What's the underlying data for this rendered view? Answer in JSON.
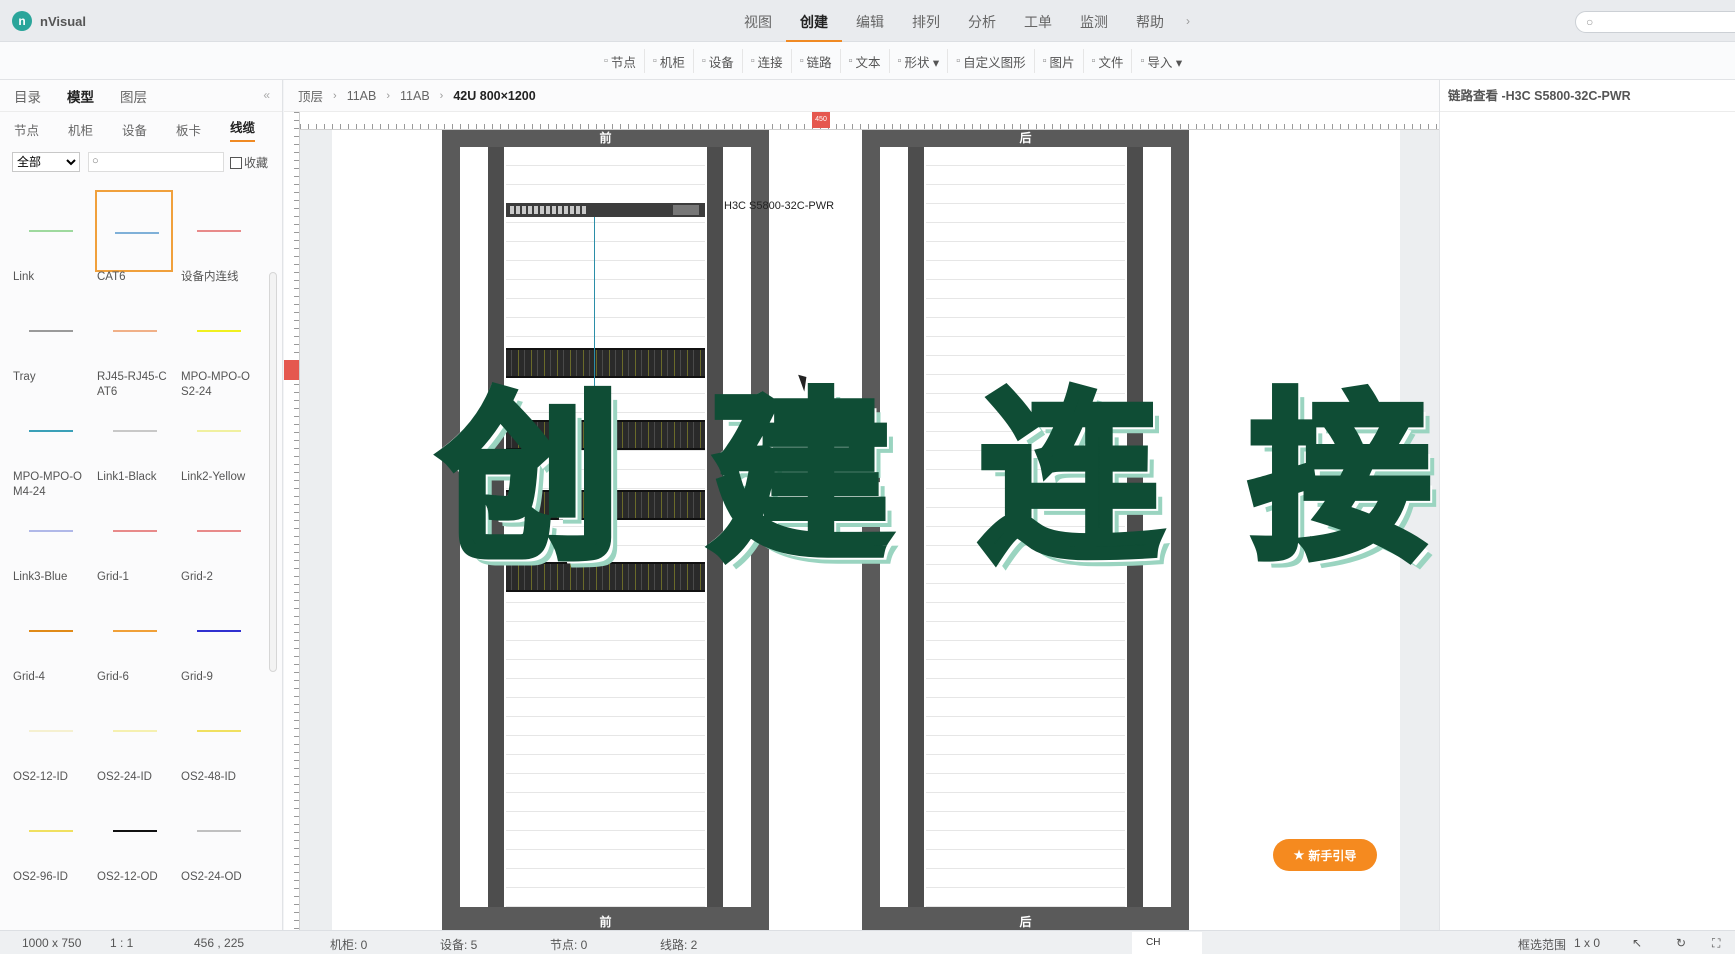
{
  "app": {
    "name": "nVisual"
  },
  "menu": {
    "items": [
      "视图",
      "创建",
      "编辑",
      "排列",
      "分析",
      "工单",
      "监测",
      "帮助"
    ],
    "active": "创建"
  },
  "toolbar": {
    "items": [
      {
        "label": "节点",
        "icon": "node-icon"
      },
      {
        "label": "机柜",
        "icon": "cabinet-icon"
      },
      {
        "label": "设备",
        "icon": "device-icon"
      },
      {
        "label": "连接",
        "icon": "connect-icon"
      },
      {
        "label": "链路",
        "icon": "link-icon"
      },
      {
        "label": "文本",
        "icon": "text-icon"
      },
      {
        "label": "形状 ▾",
        "icon": "shape-icon"
      },
      {
        "label": "自定义图形",
        "icon": "custom-shape-icon"
      },
      {
        "label": "图片",
        "icon": "image-icon"
      },
      {
        "label": "文件",
        "icon": "file-icon"
      },
      {
        "label": "导入 ▾",
        "icon": "import-icon"
      }
    ]
  },
  "sidebar": {
    "tabs": [
      "目录",
      "模型",
      "图层"
    ],
    "active_tab": "模型",
    "collapse_label": "«",
    "subtabs": [
      "节点",
      "机柜",
      "设备",
      "板卡",
      "线缆"
    ],
    "active_subtab": "线缆",
    "filter_value": "全部",
    "favorite_label": "收藏",
    "lines": [
      {
        "label": "Link",
        "color": "#9ed99e"
      },
      {
        "label": "CAT6",
        "color": "#7fb0d8",
        "selected": true
      },
      {
        "label": "设备内连线",
        "color": "#e88a8a"
      },
      {
        "label": "Tray",
        "color": "#9a9a9a"
      },
      {
        "label": "RJ45-RJ45-CAT6",
        "color": "#f0b088"
      },
      {
        "label": "MPO-MPO-OS2-24",
        "color": "#f0f020"
      },
      {
        "label": "MPO-MPO-OM4-24",
        "color": "#3aa0b8"
      },
      {
        "label": "Link1-Black",
        "color": "#c8c8c8"
      },
      {
        "label": "Link2-Yellow",
        "color": "#f0f0a0"
      },
      {
        "label": "Link3-Blue",
        "color": "#b0b8e8"
      },
      {
        "label": "Grid-1",
        "color": "#e88a8a"
      },
      {
        "label": "Grid-2",
        "color": "#e88a8a"
      },
      {
        "label": "Grid-4",
        "color": "#e08a18"
      },
      {
        "label": "Grid-6",
        "color": "#f0a038"
      },
      {
        "label": "Grid-9",
        "color": "#3030d0"
      },
      {
        "label": "OS2-12-ID",
        "color": "#f5f0d0"
      },
      {
        "label": "OS2-24-ID",
        "color": "#f5f0b0"
      },
      {
        "label": "OS2-48-ID",
        "color": "#f0e060"
      },
      {
        "label": "OS2-96-ID",
        "color": "#f0e060"
      },
      {
        "label": "OS2-12-OD",
        "color": "#111111"
      },
      {
        "label": "OS2-24-OD",
        "color": "#c0c0c0"
      }
    ]
  },
  "breadcrumb": {
    "items": [
      "顶层",
      "11AB",
      "11AB",
      "42U 800×1200"
    ]
  },
  "ruler": {
    "h_marker": "450",
    "v_marker": "225"
  },
  "canvas": {
    "rack_front_label": "前",
    "rack_back_label": "后",
    "device_label": "H3C S5800-32C-PWR"
  },
  "overlay_text": [
    "创",
    "建",
    "连",
    "接"
  ],
  "right_panel": {
    "title": "链路查看 -H3C S5800-32C-PWR"
  },
  "guide_button": {
    "label": "新手引导",
    "icon": "star-icon"
  },
  "statusbar": {
    "size": "1000 x 750",
    "scale": "1 : 1",
    "coords": "456 , 225",
    "cabinets": "机柜: 0",
    "devices": "设备: 5",
    "nodes": "节点: 0",
    "lines": "线路: 2",
    "ime": "CH",
    "selection": "框选范围",
    "selection_value": "1 x 0"
  },
  "colors": {
    "accent": "#f08a24",
    "overlay_text": "#0f4d35",
    "rack": "#5a5a5a"
  }
}
